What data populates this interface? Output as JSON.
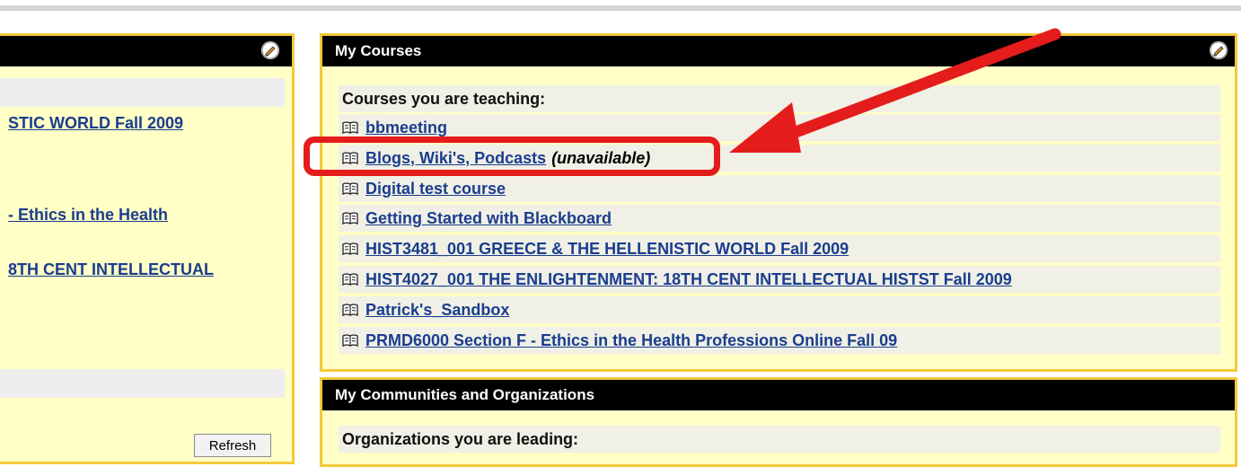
{
  "left_panel": {
    "links": [
      "STIC WORLD Fall 2009",
      "- Ethics in the Health",
      "8TH CENT INTELLECTUAL"
    ],
    "refresh_label": "Refresh"
  },
  "courses": {
    "header": "My Courses",
    "subtitle": "Courses you are teaching:",
    "items": [
      {
        "label": "bbmeeting",
        "status": ""
      },
      {
        "label": "Blogs, Wiki's, Podcasts",
        "status": "(unavailable)"
      },
      {
        "label": "Digital test course",
        "status": ""
      },
      {
        "label": "Getting Started with Blackboard",
        "status": ""
      },
      {
        "label": "HIST3481_001 GREECE & THE HELLENISTIC WORLD Fall 2009",
        "status": ""
      },
      {
        "label": "HIST4027_001 THE ENLIGHTENMENT: 18TH CENT INTELLECTUAL HISTST Fall 2009",
        "status": ""
      },
      {
        "label": "Patrick's_Sandbox",
        "status": ""
      },
      {
        "label": "PRMD6000 Section F - Ethics in the Health Professions Online Fall 09",
        "status": ""
      }
    ]
  },
  "communities": {
    "header": "My Communities and Organizations",
    "subtitle": "Organizations you are leading:"
  },
  "colors": {
    "panel_bg": "#ffffc6",
    "panel_border": "#f3c93a",
    "header_bg": "#000000",
    "link": "#1a3d8f",
    "annotation": "#e51c1c"
  },
  "icons": {
    "edit": "pencil-edit-icon",
    "course": "open-book-icon",
    "annotation_arrow": "red-arrow-icon"
  }
}
